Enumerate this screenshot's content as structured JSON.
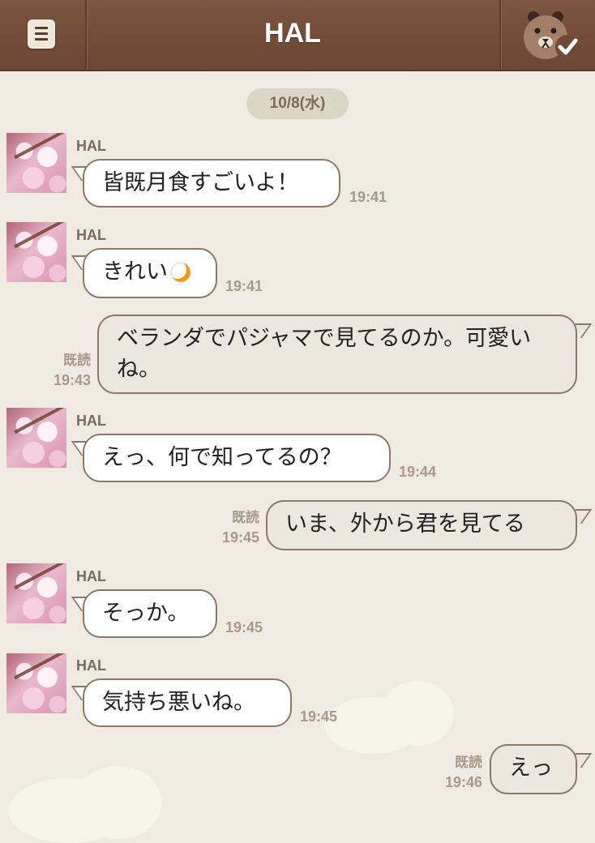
{
  "header": {
    "title": "HAL",
    "menu_icon": "menu-list-icon",
    "right_icon": "bear-checkmark-icon"
  },
  "date_label": "10/8(水)",
  "read_label": "既読",
  "sender": "HAL",
  "messages": [
    {
      "direction": "in",
      "text": "皆既月食すごいよ！",
      "time": "19:41"
    },
    {
      "direction": "in",
      "text": "きれい",
      "emoji": "crescent-moon-icon",
      "time": "19:41"
    },
    {
      "direction": "out",
      "text": "ベランダでパジャマで見てるのか。可愛いね。",
      "time": "19:43",
      "read": true
    },
    {
      "direction": "in",
      "text": "えっ、何で知ってるの？",
      "time": "19:44"
    },
    {
      "direction": "out",
      "text": "いま、外から君を見てる",
      "time": "19:45",
      "read": true
    },
    {
      "direction": "in",
      "text": "そっか。",
      "time": "19:45"
    },
    {
      "direction": "in",
      "text": "気持ち悪いね。",
      "time": "19:45"
    },
    {
      "direction": "out",
      "text": "えっ",
      "time": "19:46",
      "read": true
    }
  ],
  "colors": {
    "header": "#6f4a36",
    "background": "#efebe0",
    "incoming_bubble": "#ffffff",
    "outgoing_bubble": "#ebe6de",
    "bubble_border": "#8e7767",
    "meta_text": "#a8998a"
  }
}
